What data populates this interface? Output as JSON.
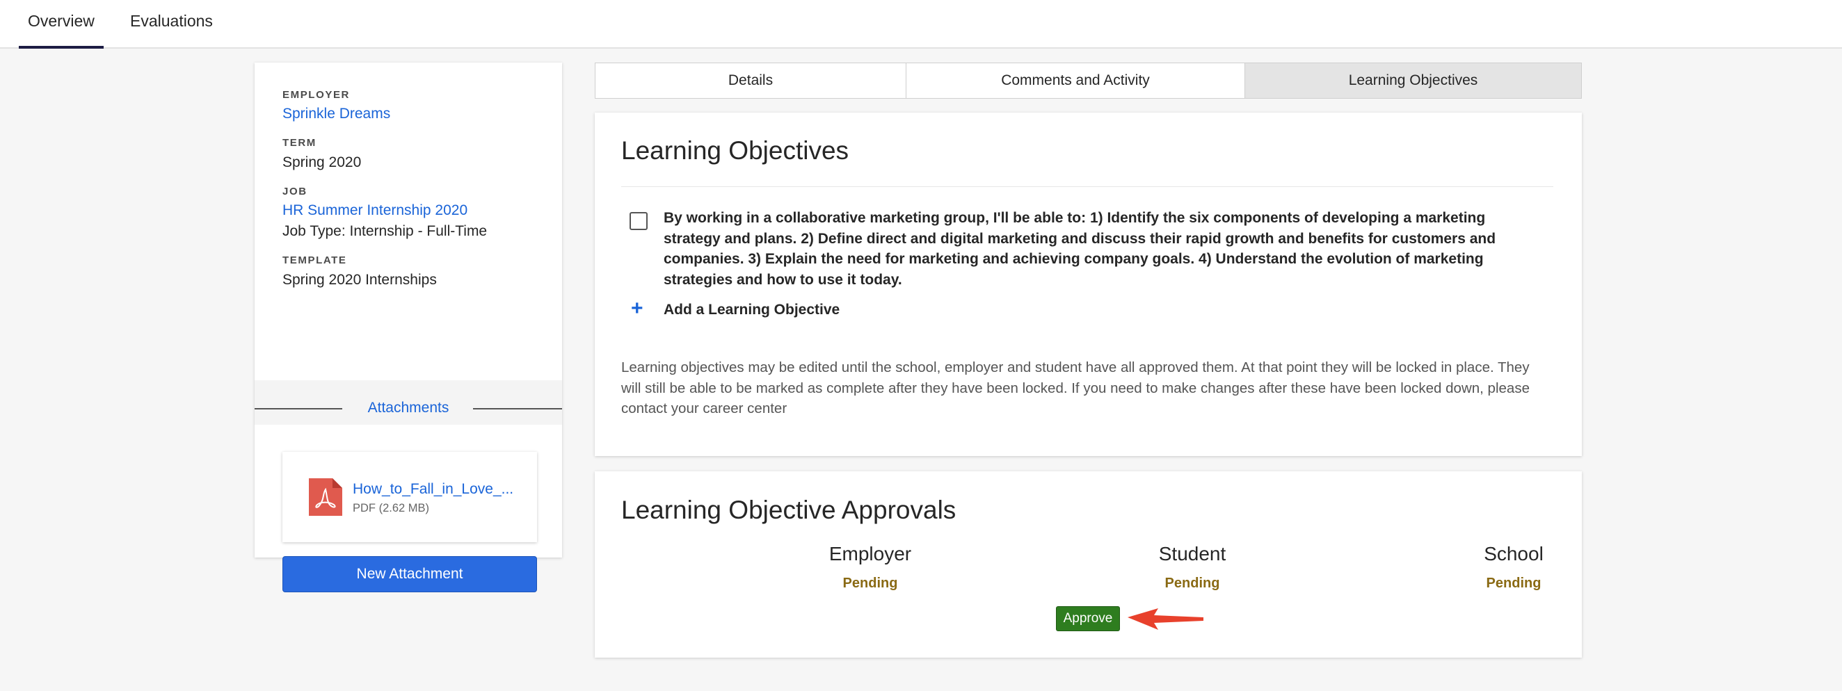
{
  "topnav": {
    "tabs": [
      "Overview",
      "Evaluations"
    ],
    "active": "Overview"
  },
  "sidebar": {
    "employer_label": "EMPLOYER",
    "employer": "Sprinkle Dreams",
    "term_label": "TERM",
    "term": "Spring 2020",
    "job_label": "JOB",
    "job": "HR Summer Internship 2020",
    "job_type": "Job Type: Internship - Full-Time",
    "template_label": "TEMPLATE",
    "template": "Spring 2020 Internships",
    "attachments_title": "Attachments",
    "attachment": {
      "name": "How_to_Fall_in_Love_...",
      "meta": "PDF (2.62 MB)"
    },
    "new_attachment_label": "New Attachment"
  },
  "subtabs": [
    "Details",
    "Comments and Activity",
    "Learning Objectives"
  ],
  "active_subtab": "Learning Objectives",
  "objectives": {
    "title": "Learning Objectives",
    "items": [
      {
        "checked": false,
        "text": "By working in a collaborative marketing group, I'll be able to: 1) Identify the six components of developing a marketing strategy and plans. 2) Define direct and digital marketing and discuss their rapid growth and benefits for customers and companies. 3) Explain the need for marketing and achieving company goals. 4) Understand the evolution of marketing strategies and how to use it today."
      }
    ],
    "add_label": "Add a Learning Objective",
    "note": "Learning objectives may be edited until the school, employer and student have all approved them. At that point they will be locked in place. They will still be able to be marked as complete after they have been locked. If you need to make changes after these have been locked down, please contact your career center"
  },
  "approvals": {
    "title": "Learning Objective Approvals",
    "columns": [
      {
        "name": "Employer",
        "status": "Pending"
      },
      {
        "name": "Student",
        "status": "Pending"
      },
      {
        "name": "School",
        "status": "Pending"
      }
    ],
    "approve_label": "Approve"
  },
  "colors": {
    "link": "#1a64d8",
    "pending": "#8a6a14",
    "approve": "#2e7d1f",
    "primary_button": "#2a6be0",
    "annotation_arrow": "#e8412c",
    "pdf_icon": "#e05a4e"
  },
  "icons": [
    "pdf-file-icon",
    "plus-icon",
    "red-arrow-annotation"
  ]
}
